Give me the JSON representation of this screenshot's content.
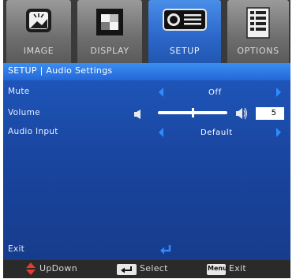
{
  "tabs": [
    {
      "label": "IMAGE",
      "icon": "image-icon"
    },
    {
      "label": "DISPLAY",
      "icon": "display-icon"
    },
    {
      "label": "SETUP",
      "icon": "projector-icon",
      "active": true
    },
    {
      "label": "OPTIONS",
      "icon": "options-icon"
    }
  ],
  "section": {
    "title": "SETUP | Audio Settings"
  },
  "rows": {
    "mute": {
      "label": "Mute",
      "value": "Off"
    },
    "volume": {
      "label": "Volume",
      "value": "5",
      "level": 0.5
    },
    "audio_input": {
      "label": "Audio Input",
      "value": "Default"
    },
    "exit": {
      "label": "Exit"
    }
  },
  "bottom": {
    "updown": "UpDown",
    "select": "Select",
    "menu_key": "Menu",
    "exit": "Exit"
  },
  "colors": {
    "accent": "#2f8cff",
    "panel": "#1a46a0",
    "header": "#2b78e6",
    "tab_active": "#2b66c8"
  }
}
